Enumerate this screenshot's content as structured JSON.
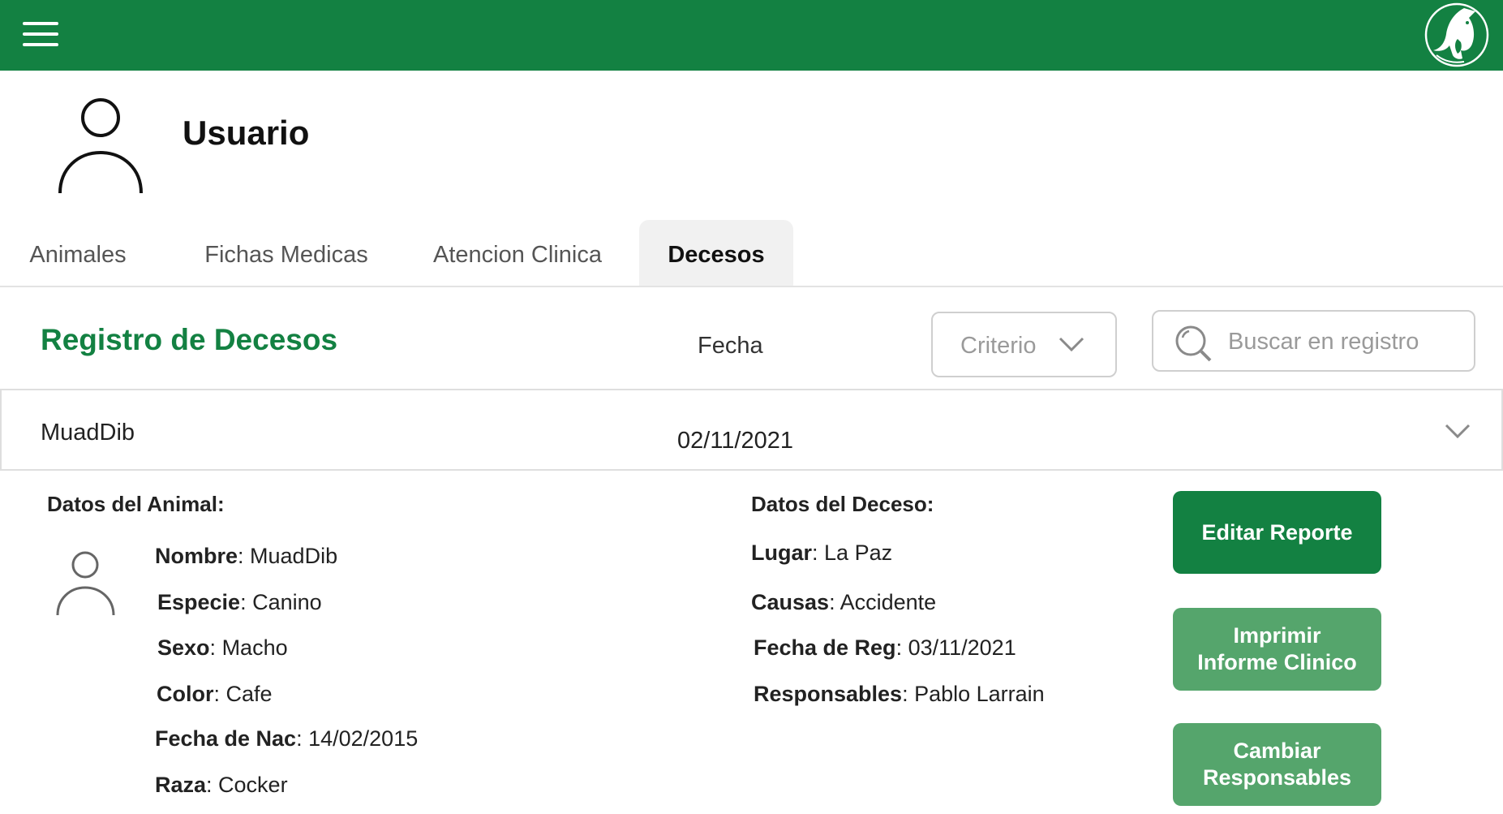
{
  "header": {
    "menu_icon": "hamburger-menu-icon",
    "logo_icon": "animal-logo-icon",
    "bar_color": "#138142"
  },
  "user": {
    "name": "Usuario",
    "avatar_icon": "user-avatar-icon"
  },
  "tabs": [
    {
      "label": "Animales",
      "active": false
    },
    {
      "label": "Fichas Medicas",
      "active": false
    },
    {
      "label": "Atencion Clinica",
      "active": false
    },
    {
      "label": "Decesos",
      "active": true
    }
  ],
  "section": {
    "title": "Registro de Decesos",
    "fecha_label": "Fecha",
    "criterio_label": "Criterio",
    "search_placeholder": "Buscar en registro",
    "search_value": ""
  },
  "record": {
    "name": "MuadDib",
    "date": "02/11/2021",
    "expanded": true
  },
  "animal": {
    "title": "Datos del Animal:",
    "fields": [
      {
        "label": "Nombre",
        "value": "MuadDib"
      },
      {
        "label": "Especie",
        "value": "Canino"
      },
      {
        "label": "Sexo",
        "value": "Macho"
      },
      {
        "label": "Color",
        "value": "Cafe"
      },
      {
        "label": "Fecha de Nac",
        "value": "14/02/2015"
      },
      {
        "label": "Raza",
        "value": "Cocker"
      }
    ]
  },
  "deceso": {
    "title": "Datos del Deceso:",
    "fields": [
      {
        "label": "Lugar",
        "value": "La Paz"
      },
      {
        "label": "Causas",
        "value": "Accidente"
      },
      {
        "label": "Fecha de Reg",
        "value": "03/11/2021"
      },
      {
        "label": "Responsables",
        "value": "Pablo Larrain"
      }
    ]
  },
  "actions": {
    "edit": [
      "Editar Reporte"
    ],
    "print": [
      "Imprimir",
      "Informe Clinico"
    ],
    "change": [
      "Cambiar",
      "Responsables"
    ]
  },
  "colors": {
    "primary": "#138142",
    "secondary": "#55a56c",
    "active_tab_bg": "#f1f1f1"
  }
}
